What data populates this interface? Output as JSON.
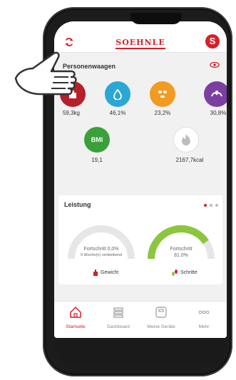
{
  "app": {
    "brand": "SOEHNLE",
    "logo_letter": "S"
  },
  "section": {
    "title": "Personenwaagen"
  },
  "metrics": [
    {
      "value": "59,3kg",
      "color": "#b5202a",
      "icon": "weight-icon"
    },
    {
      "value": "46,1%",
      "color": "#2aa7d4",
      "icon": "water-drop-icon"
    },
    {
      "value": "23,2%",
      "color": "#f39a22",
      "icon": "fat-face-icon"
    },
    {
      "value": "30,8%",
      "color": "#7a3fa0",
      "icon": "muscle-icon"
    },
    {
      "value": "19,1",
      "color": "#3aa03a",
      "icon": "bmi-icon",
      "badge": "BMI"
    },
    {
      "value": "2167,7kcal",
      "color": "#ffffff",
      "icon": "flame-icon"
    }
  ],
  "leistung": {
    "title": "Leistung",
    "weight_progress": {
      "line1": "Fortschritt 0,0%",
      "line2": "9 Woche(n) verbleibend",
      "fraction": 0.0
    },
    "steps_progress": {
      "line1": "Fortschritt",
      "line2": "81.0%",
      "fraction": 0.81
    },
    "legend_weight": "Gewicht",
    "legend_steps": "Schritte"
  },
  "tabs": [
    {
      "label": "Startseite",
      "icon": "home-icon",
      "active": true
    },
    {
      "label": "Dashboard",
      "icon": "dashboard-icon",
      "active": false
    },
    {
      "label": "Meine Geräte",
      "icon": "scale-device-icon",
      "active": false
    },
    {
      "label": "Mehr",
      "icon": "more-icon",
      "active": false
    }
  ],
  "colors": {
    "accent": "#d62027",
    "gauge_track": "#e6e6e6",
    "steps_green": "#8cc63f"
  }
}
